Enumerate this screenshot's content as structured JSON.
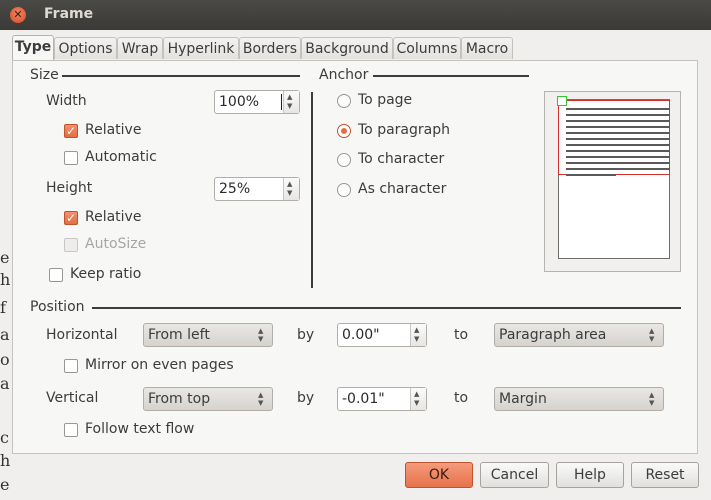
{
  "window": {
    "title": "Frame"
  },
  "tabs": [
    {
      "label": "Type",
      "active": true
    },
    {
      "label": "Options"
    },
    {
      "label": "Wrap"
    },
    {
      "label": "Hyperlink"
    },
    {
      "label": "Borders"
    },
    {
      "label": "Background"
    },
    {
      "label": "Columns"
    },
    {
      "label": "Macro"
    }
  ],
  "size": {
    "heading": "Size",
    "width_label": "Width",
    "width_value": "100%",
    "width_relative_label": "Relative",
    "width_relative_checked": true,
    "automatic_label": "Automatic",
    "automatic_checked": false,
    "height_label": "Height",
    "height_value": "25%",
    "height_relative_label": "Relative",
    "height_relative_checked": true,
    "autosize_label": "AutoSize",
    "autosize_checked": false,
    "keep_ratio_label": "Keep ratio",
    "keep_ratio_checked": false
  },
  "anchor": {
    "heading": "Anchor",
    "options": [
      "To page",
      "To paragraph",
      "To character",
      "As character"
    ],
    "selected": "To paragraph"
  },
  "position": {
    "heading": "Position",
    "horizontal_label": "Horizontal",
    "horizontal_value": "From left",
    "horizontal_by_label": "by",
    "horizontal_by_value": "0.00\"",
    "horizontal_to_label": "to",
    "horizontal_to_value": "Paragraph area",
    "mirror_label": "Mirror on even pages",
    "mirror_checked": false,
    "vertical_label": "Vertical",
    "vertical_value": "From top",
    "vertical_by_label": "by",
    "vertical_by_value": "-0.01\"",
    "vertical_to_label": "to",
    "vertical_to_value": "Margin",
    "follow_label": "Follow text flow",
    "follow_checked": false
  },
  "buttons": {
    "ok": "OK",
    "cancel": "Cancel",
    "help": "Help",
    "reset": "Reset"
  },
  "background_doc": {
    "chars": [
      "e",
      "h",
      "f",
      "a",
      "o",
      "a",
      "c",
      "h",
      "e"
    ]
  },
  "colors": {
    "accent": "#e56d40",
    "titlebar": "#3b3a36",
    "anchor_marker": "#35c535",
    "frame_outline": "#d53030"
  }
}
